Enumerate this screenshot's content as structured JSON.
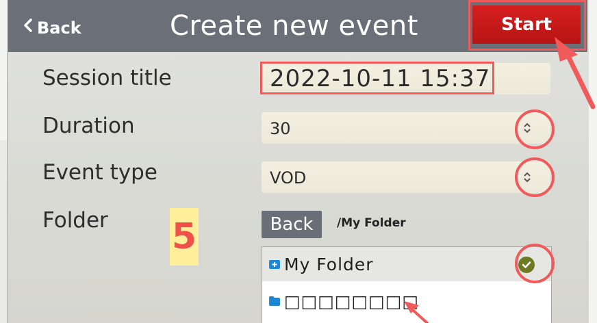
{
  "header": {
    "back_label": "Back",
    "title": "Create new event",
    "start_label": "Start"
  },
  "form": {
    "session_title": {
      "label": "Session title",
      "value": "2022-10-11 15:37"
    },
    "duration": {
      "label": "Duration",
      "value": "30"
    },
    "event_type": {
      "label": "Event type",
      "value": "VOD"
    },
    "folder": {
      "label": "Folder",
      "back_label": "Back",
      "path": "/My Folder",
      "items": [
        {
          "name": "My Folder",
          "selected": true
        },
        {
          "name": "□□□□□□□□",
          "selected": false
        }
      ]
    }
  },
  "annotation": {
    "step_number": "5"
  },
  "colors": {
    "header_bg": "#6b6f78",
    "start_button": "#c81a1a",
    "highlight": "#f05a5a",
    "check": "#6d7a22",
    "folder_icon": "#1e88d6"
  },
  "icons": [
    "chevron-left-icon",
    "up-down-spinner-icon",
    "folder-plus-icon",
    "folder-icon",
    "checkmark-icon",
    "annotation-arrow-icon"
  ]
}
